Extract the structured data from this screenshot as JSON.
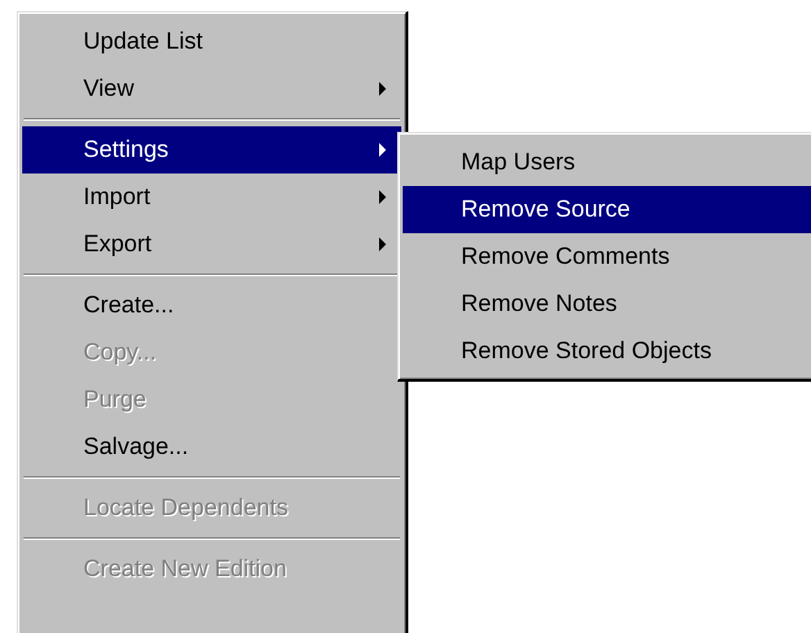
{
  "menu": {
    "items": [
      {
        "kind": "item",
        "label": "Update List",
        "submenu": false,
        "disabled": false,
        "selected": false
      },
      {
        "kind": "item",
        "label": "View",
        "submenu": true,
        "disabled": false,
        "selected": false
      },
      {
        "kind": "separator"
      },
      {
        "kind": "item",
        "label": "Settings",
        "submenu": true,
        "disabled": false,
        "selected": true
      },
      {
        "kind": "item",
        "label": "Import",
        "submenu": true,
        "disabled": false,
        "selected": false
      },
      {
        "kind": "item",
        "label": "Export",
        "submenu": true,
        "disabled": false,
        "selected": false
      },
      {
        "kind": "separator"
      },
      {
        "kind": "item",
        "label": "Create...",
        "submenu": false,
        "disabled": false,
        "selected": false
      },
      {
        "kind": "item",
        "label": "Copy...",
        "submenu": false,
        "disabled": true,
        "selected": false
      },
      {
        "kind": "item",
        "label": "Purge",
        "submenu": false,
        "disabled": true,
        "selected": false
      },
      {
        "kind": "item",
        "label": "Salvage...",
        "submenu": false,
        "disabled": false,
        "selected": false
      },
      {
        "kind": "separator"
      },
      {
        "kind": "item",
        "label": "Locate Dependents",
        "submenu": false,
        "disabled": true,
        "selected": false
      },
      {
        "kind": "separator"
      },
      {
        "kind": "item",
        "label": "Create New Edition",
        "submenu": false,
        "disabled": true,
        "selected": false
      }
    ]
  },
  "submenu": {
    "items": [
      {
        "kind": "item",
        "label": "Map Users",
        "disabled": false,
        "selected": false
      },
      {
        "kind": "item",
        "label": "Remove Source",
        "disabled": false,
        "selected": true
      },
      {
        "kind": "item",
        "label": "Remove Comments",
        "disabled": false,
        "selected": false
      },
      {
        "kind": "item",
        "label": "Remove Notes",
        "disabled": false,
        "selected": false
      },
      {
        "kind": "item",
        "label": "Remove Stored Objects",
        "disabled": false,
        "selected": false
      }
    ]
  }
}
